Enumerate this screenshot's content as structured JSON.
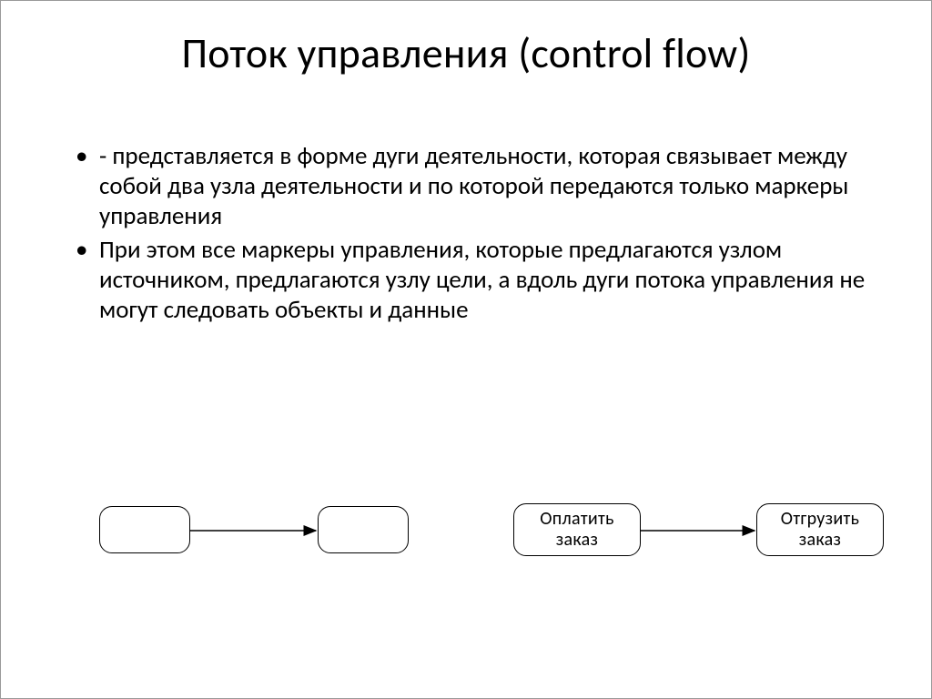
{
  "title": "Поток управления (control flow)",
  "bullets": [
    "- представляется в форме дуги деятельности, которая связывает между собой два узла деятельности и по которой передаются только маркеры управления",
    "При этом все маркеры управления, которые предлагаются узлом источником, предлагаются узлу цели, а вдоль дуги потока управления не могут следовать объекты и данные"
  ],
  "diagram": {
    "left_pair": {
      "node_a": "",
      "node_b": ""
    },
    "right_pair": {
      "node_a": "Оплатить заказ",
      "node_b": "Отгрузить заказ"
    }
  }
}
